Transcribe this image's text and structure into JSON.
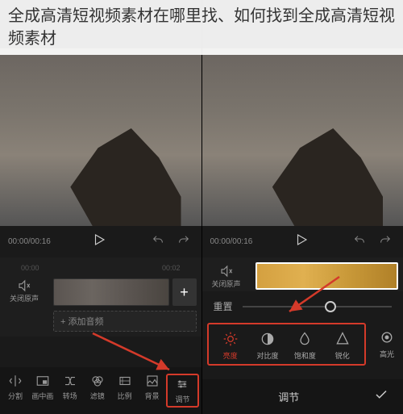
{
  "header": {
    "title": "全成高清短视频素材在哪里找、如何找到全成高清短视频素材"
  },
  "playback": {
    "time": "00:00/00:16"
  },
  "timeline": {
    "marks": [
      "00:00",
      "00:02"
    ],
    "mute_label": "关闭原声",
    "add_audio": "+ 添加音频"
  },
  "bottom_toolbar": {
    "items": [
      {
        "label": "分割"
      },
      {
        "label": "画中画"
      },
      {
        "label": "转场"
      },
      {
        "label": "滤镜"
      },
      {
        "label": "比例"
      },
      {
        "label": "背景"
      },
      {
        "label": "调节"
      }
    ]
  },
  "adjust": {
    "reset_label": "重置",
    "items": [
      {
        "label": "亮度"
      },
      {
        "label": "对比度"
      },
      {
        "label": "饱和度"
      },
      {
        "label": "锐化"
      }
    ],
    "extra": {
      "label": "高光"
    },
    "confirm_title": "调节"
  },
  "colors": {
    "annotation": "#d43a2a"
  }
}
